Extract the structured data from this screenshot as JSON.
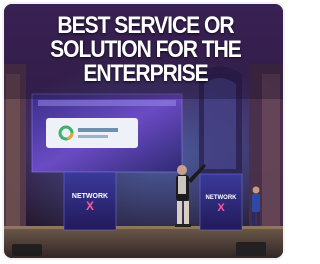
{
  "headline": {
    "line1": "BEST SERVICE OR",
    "line2": "SOLUTION FOR THE",
    "line3": "ENTERPRISE"
  },
  "event_branding": {
    "logo_word": "NETWORK",
    "logo_mark": "X"
  },
  "colors": {
    "stage_purple": "#3b1f5c",
    "spotlight_blue": "#4a7fd6",
    "card_border": "#f2f2f2",
    "headline_text": "#ffffff"
  }
}
